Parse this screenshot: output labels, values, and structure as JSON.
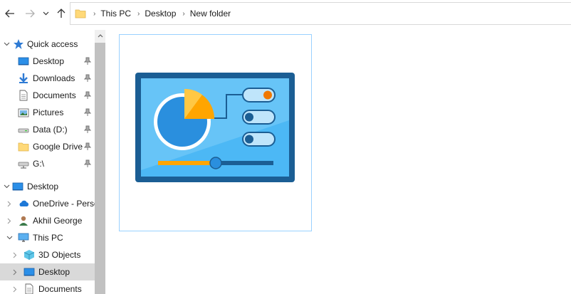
{
  "toolbar": {
    "back": "back-arrow",
    "forward": "forward-arrow",
    "recent": "chevron-down",
    "up": "up-arrow"
  },
  "address": {
    "crumbs": [
      "This PC",
      "Desktop",
      "New folder"
    ]
  },
  "nav": {
    "quick_access": "Quick access",
    "items": [
      {
        "label": "Desktop",
        "icon": "desktop-icon",
        "pinned": true
      },
      {
        "label": "Downloads",
        "icon": "download-icon",
        "pinned": true
      },
      {
        "label": "Documents",
        "icon": "document-icon",
        "pinned": true
      },
      {
        "label": "Pictures",
        "icon": "pictures-icon",
        "pinned": true
      },
      {
        "label": "Data (D:)",
        "icon": "drive-icon",
        "pinned": true
      },
      {
        "label": "Google Drive",
        "icon": "folder-icon",
        "pinned": true
      },
      {
        "label": "G:\\",
        "icon": "network-drive-icon",
        "pinned": true
      }
    ],
    "desktop_root": "Desktop",
    "onedrive": "OneDrive - Perso",
    "user": "Akhil George",
    "this_pc": "This PC",
    "this_pc_items": [
      "3D Objects",
      "Desktop",
      "Documents"
    ]
  },
  "content": {
    "item_icon": "control-panel-icon"
  },
  "colors": {
    "accent": "#1e90ff",
    "selected_bg": "#d9d9d9",
    "tile_border": "#99d1ff"
  }
}
